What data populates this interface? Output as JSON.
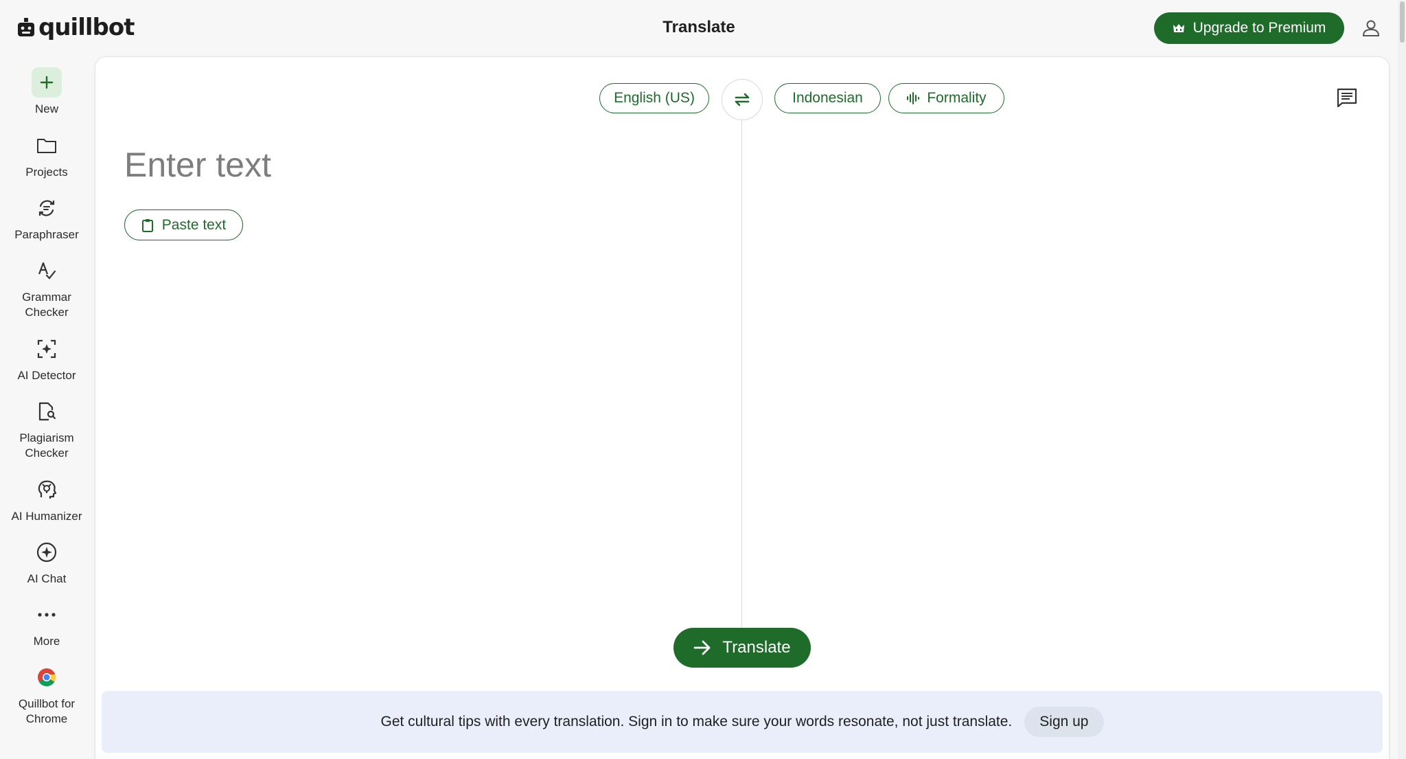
{
  "app": {
    "brand": "quillbot",
    "page_title": "Translate",
    "premium_label": "Upgrade to Premium"
  },
  "sidebar": {
    "items": [
      {
        "label": "New",
        "icon": "plus-icon"
      },
      {
        "label": "Projects",
        "icon": "folder-icon"
      },
      {
        "label": "Paraphraser",
        "icon": "paraphraser-icon"
      },
      {
        "label": "Grammar Checker",
        "icon": "grammar-icon"
      },
      {
        "label": "AI Detector",
        "icon": "ai-detector-icon"
      },
      {
        "label": "Plagiarism Checker",
        "icon": "plagiarism-icon"
      },
      {
        "label": "AI Humanizer",
        "icon": "humanizer-icon"
      },
      {
        "label": "AI Chat",
        "icon": "ai-chat-icon"
      },
      {
        "label": "More",
        "icon": "more-icon"
      },
      {
        "label": "Quillbot for Chrome",
        "icon": "chrome-icon"
      }
    ]
  },
  "translator": {
    "source_language": "English (US)",
    "target_language": "Indonesian",
    "formality_label": "Formality",
    "input_placeholder": "Enter text",
    "paste_label": "Paste text",
    "translate_label": "Translate"
  },
  "banner": {
    "text": "Get cultural tips with every translation. Sign in to make sure your words resonate, not just translate.",
    "signup_label": "Sign up"
  },
  "colors": {
    "brand_green": "#1e6b2a",
    "active_bg": "#dcefdc",
    "banner_bg": "#e9eefa"
  }
}
